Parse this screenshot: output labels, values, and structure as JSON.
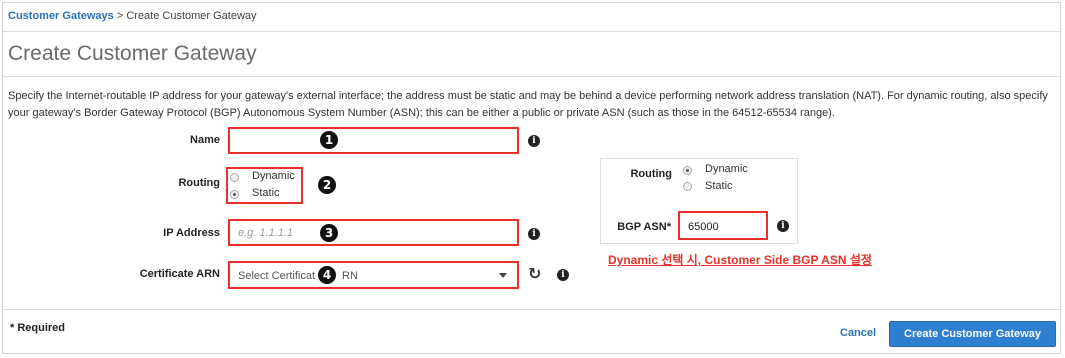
{
  "breadcrumb": {
    "parent": "Customer Gateways",
    "separator": " > ",
    "current": "Create Customer Gateway"
  },
  "page": {
    "title": "Create Customer Gateway",
    "description": "Specify the Internet-routable IP address for your gateway's external interface; the address must be static and may be behind a device performing network address translation (NAT). For dynamic routing, also specify your gateway's Border Gateway Protocol (BGP) Autonomous System Number (ASN); this can be either a public or private ASN (such as those in the 64512-65534 range)."
  },
  "form": {
    "name": {
      "label": "Name",
      "value": "",
      "badge": "1"
    },
    "routing": {
      "label": "Routing",
      "badge": "2",
      "options": [
        {
          "label": "Dynamic",
          "checked": false
        },
        {
          "label": "Static",
          "checked": true
        }
      ]
    },
    "ip_address": {
      "label": "IP Address",
      "value": "",
      "placeholder": "e.g. 1.1.1.1",
      "badge": "3"
    },
    "certificate_arn": {
      "label": "Certificate ARN",
      "placeholder_start": "Select Certificat",
      "placeholder_end": "RN",
      "badge": "4"
    }
  },
  "callout": {
    "routing_label": "Routing",
    "options": [
      {
        "label": "Dynamic",
        "checked": true
      },
      {
        "label": "Static",
        "checked": false
      }
    ],
    "bgp_asn_label": "BGP ASN*",
    "bgp_asn_value": "65000",
    "annotation": "Dynamic 선택 시, Customer Side BGP ASN 설정"
  },
  "footer": {
    "required_note": "* Required",
    "cancel_label": "Cancel",
    "submit_label": "Create Customer Gateway"
  },
  "icons": {
    "info": "info-icon",
    "refresh": "refresh-icon",
    "dropdown": "chevron-down-icon"
  },
  "colors": {
    "highlight": "#e8312a",
    "primary": "#2e7fd0",
    "link": "#2a72b5"
  }
}
